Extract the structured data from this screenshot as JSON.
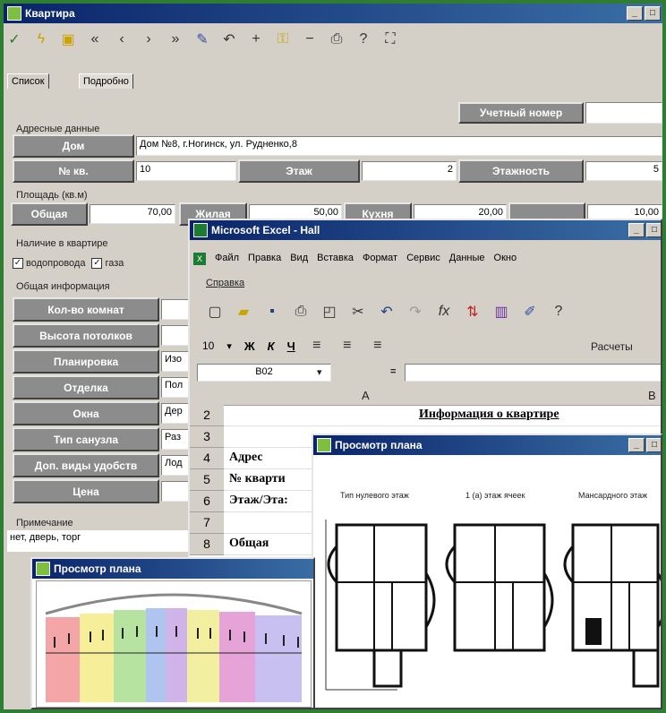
{
  "main": {
    "title": "Квартира",
    "tabs": [
      "Список",
      "Подробно"
    ],
    "account_button": "Учетный номер",
    "section_address": "Адресные данные",
    "house_label": "Дом",
    "house_value": "Дом №8, г.Ногинск, ул. Рудненко,8",
    "apt_label": "№ кв.",
    "apt_value": "10",
    "floor_label": "Этаж",
    "floor_value": "2",
    "floors_label": "Этажность",
    "floors_value": "5",
    "section_area": "Площадь (кв.м)",
    "total_label": "Общая",
    "total_value": "70,00",
    "living_label": "Жилая",
    "living_value": "50,00",
    "kitchen_label": "Кухня",
    "kitchen_value": "20,00",
    "other_value": "10,00",
    "section_presence": "Наличие в квартире",
    "chk_water": "водопровода",
    "chk_gas": "газа",
    "section_general": "Общая информация",
    "rows": [
      {
        "label": "Кол-во комнат",
        "value": ""
      },
      {
        "label": "Высота потолков",
        "value": ""
      },
      {
        "label": "Планировка",
        "value": "Изо"
      },
      {
        "label": "Отделка",
        "value": "Пол"
      },
      {
        "label": "Окна",
        "value": "Дер"
      },
      {
        "label": "Тип санузла",
        "value": "Раз"
      },
      {
        "label": "Доп. виды удобств",
        "value": "Лод"
      },
      {
        "label": "Цена",
        "value": ""
      }
    ],
    "notes_label": "Примечание",
    "notes_value": "нет, дверь, торг"
  },
  "excel": {
    "title": "Microsoft Excel - Hall",
    "menu": [
      "Файл",
      "Правка",
      "Вид",
      "Вставка",
      "Формат",
      "Сервис",
      "Данные",
      "Окно"
    ],
    "menu2": "Справка",
    "font_size": "10",
    "font_buttons": [
      "Ж",
      "К",
      "Ч"
    ],
    "calc_label": "Расчеты",
    "cell_ref": "B02",
    "formula_eq": "=",
    "col_a": "A",
    "col_b": "B",
    "rows": [
      {
        "num": "2",
        "text": "Информация о квартире"
      },
      {
        "num": "3",
        "text": ""
      },
      {
        "num": "4",
        "text": "Адрес"
      },
      {
        "num": "5",
        "text": "№ кварти"
      },
      {
        "num": "6",
        "text": "Этаж/Эта:"
      },
      {
        "num": "7",
        "text": ""
      },
      {
        "num": "8",
        "text": "Общая"
      }
    ]
  },
  "plan_small": {
    "title": "Просмотр плана",
    "captions": [
      "Тип нулевого этаж",
      "1 (а) этаж ячеек",
      "Мансардного этаж"
    ]
  },
  "plan_big": {
    "title": "Просмотр плана"
  },
  "colors": {
    "title_from": "#0a246a",
    "title_to": "#3a6ea5",
    "bg_green": "#2e7d32",
    "button_gray": "#8c8c8c"
  }
}
